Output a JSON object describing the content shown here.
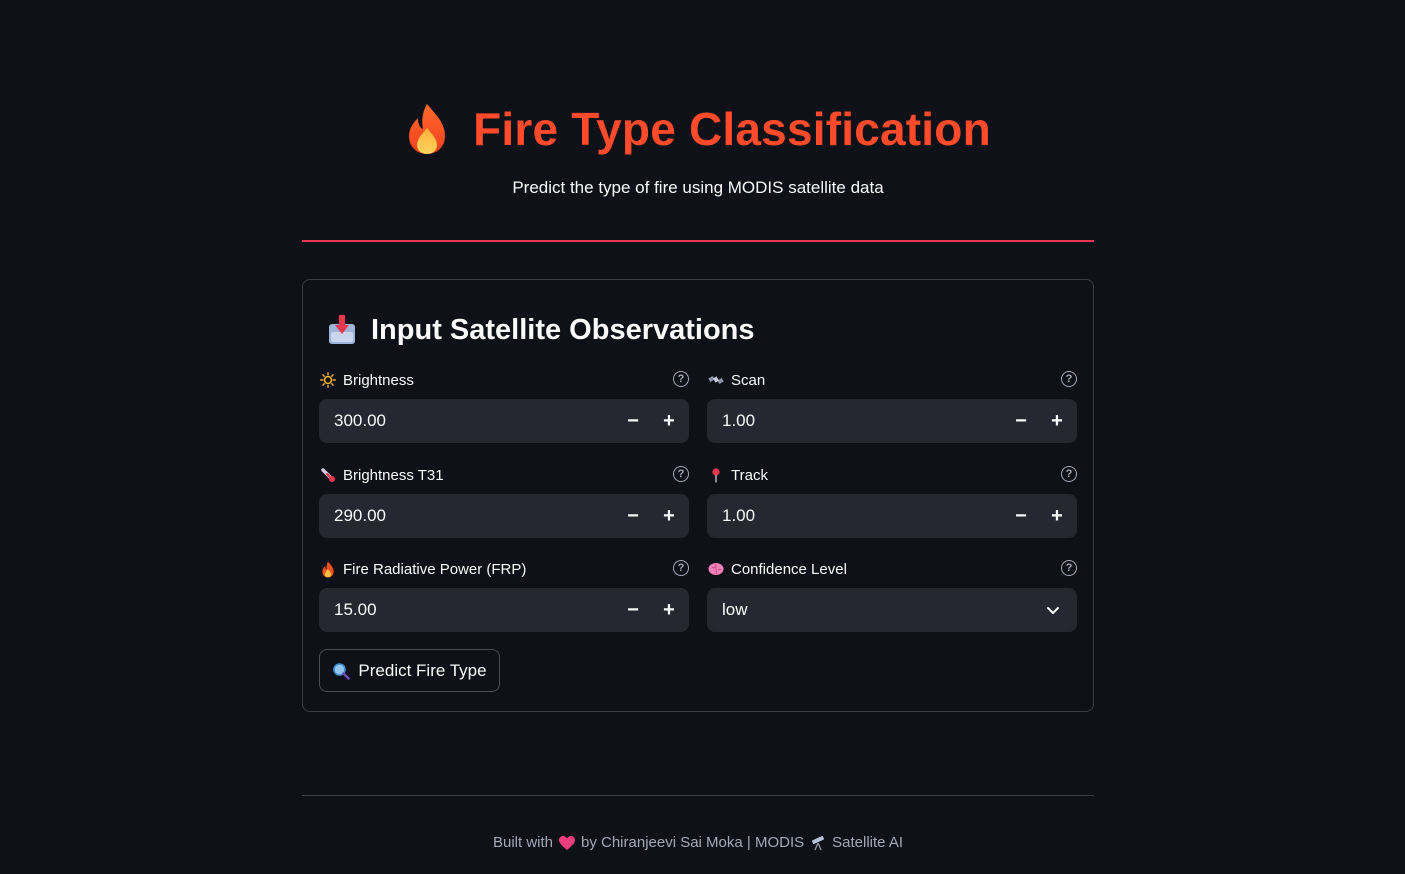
{
  "header": {
    "icon": "fire-icon",
    "title": "Fire Type Classification",
    "subtitle": "Predict the type of fire using MODIS satellite data"
  },
  "form": {
    "title_icon": "inbox-tray-icon",
    "title": "Input Satellite Observations",
    "fields": [
      {
        "icon": "sun-icon",
        "label": "Brightness",
        "value": "300.00",
        "type": "number"
      },
      {
        "icon": "satellite-icon",
        "label": "Scan",
        "value": "1.00",
        "type": "number"
      },
      {
        "icon": "thermometer-icon",
        "label": "Brightness T31",
        "value": "290.00",
        "type": "number"
      },
      {
        "icon": "pin-icon",
        "label": "Track",
        "value": "1.00",
        "type": "number"
      },
      {
        "icon": "fire-icon",
        "label": "Fire Radiative Power (FRP)",
        "value": "15.00",
        "type": "number"
      },
      {
        "icon": "brain-icon",
        "label": "Confidence Level",
        "value": "low",
        "type": "select"
      }
    ],
    "help_glyph": "?",
    "minus_glyph": "−",
    "plus_glyph": "+",
    "predict_icon": "magnifier-icon",
    "predict_label": "Predict Fire Type"
  },
  "footer": {
    "built_with": "Built with",
    "heart_icon": "heart-icon",
    "by_text": "by Chiranjeevi Sai Moka | MODIS",
    "telescope_icon": "telescope-icon",
    "suffix": "Satellite AI"
  },
  "colors": {
    "background": "#0e1117",
    "title": "#ff4b2b",
    "divider": "#e8364f",
    "input_bg": "#262730"
  }
}
